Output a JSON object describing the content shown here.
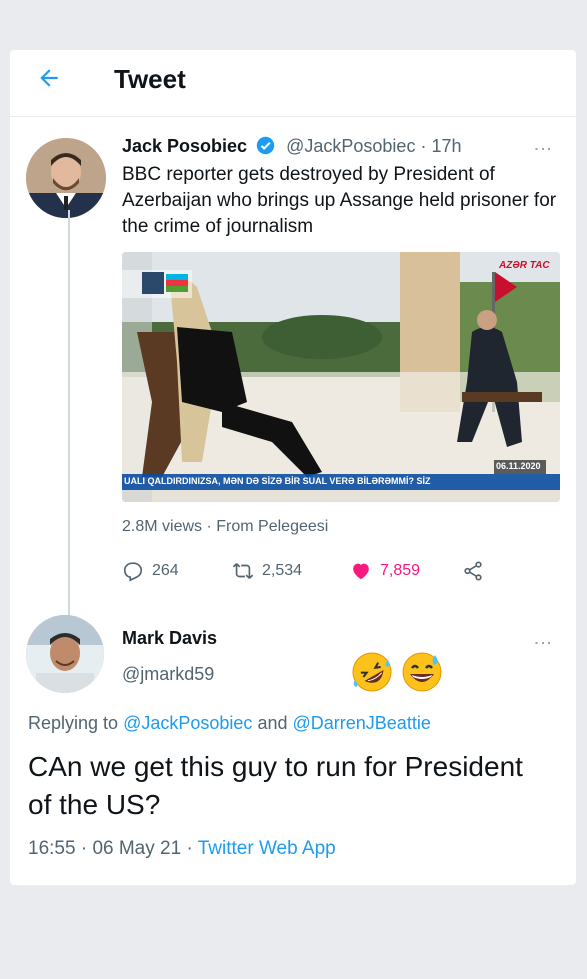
{
  "header": {
    "title": "Tweet"
  },
  "tweet": {
    "author_name": "Jack Posobiec",
    "author_handle": "@JackPosobiec",
    "time": "17h",
    "text": "BBC reporter gets destroyed by President of Azerbaijan who brings up Assange held prisoner for the crime of journalism",
    "media": {
      "watermark": "AZƏR TAC",
      "date_badge": "06.11.2020",
      "ticker": "UALI QALDIRDINIZSA, MƏN DƏ SİZƏ BİR SUAL VERƏ BİLƏRƏMMİ? SİZ"
    },
    "views": "2.8M views",
    "source": "From Pelegeesi",
    "replies": "264",
    "retweets": "2,534",
    "likes": "7,859"
  },
  "reply": {
    "author_name": "Mark Davis",
    "author_handle": "@jmarkd59",
    "emojis": [
      "rolling-on-floor-laughing",
      "grinning-sweat"
    ],
    "replying_prefix": "Replying to",
    "replying_to_1": "@JackPosobiec",
    "replying_and": "and",
    "replying_to_2": "@DarrenJBeattie",
    "text": "CAn we get this guy to run for President of the US?",
    "time": "16:55",
    "date": "06 May 21",
    "client": "Twitter Web App"
  },
  "colors": {
    "accent": "#1d9bf0",
    "like": "#f91880",
    "muted": "#536471"
  }
}
